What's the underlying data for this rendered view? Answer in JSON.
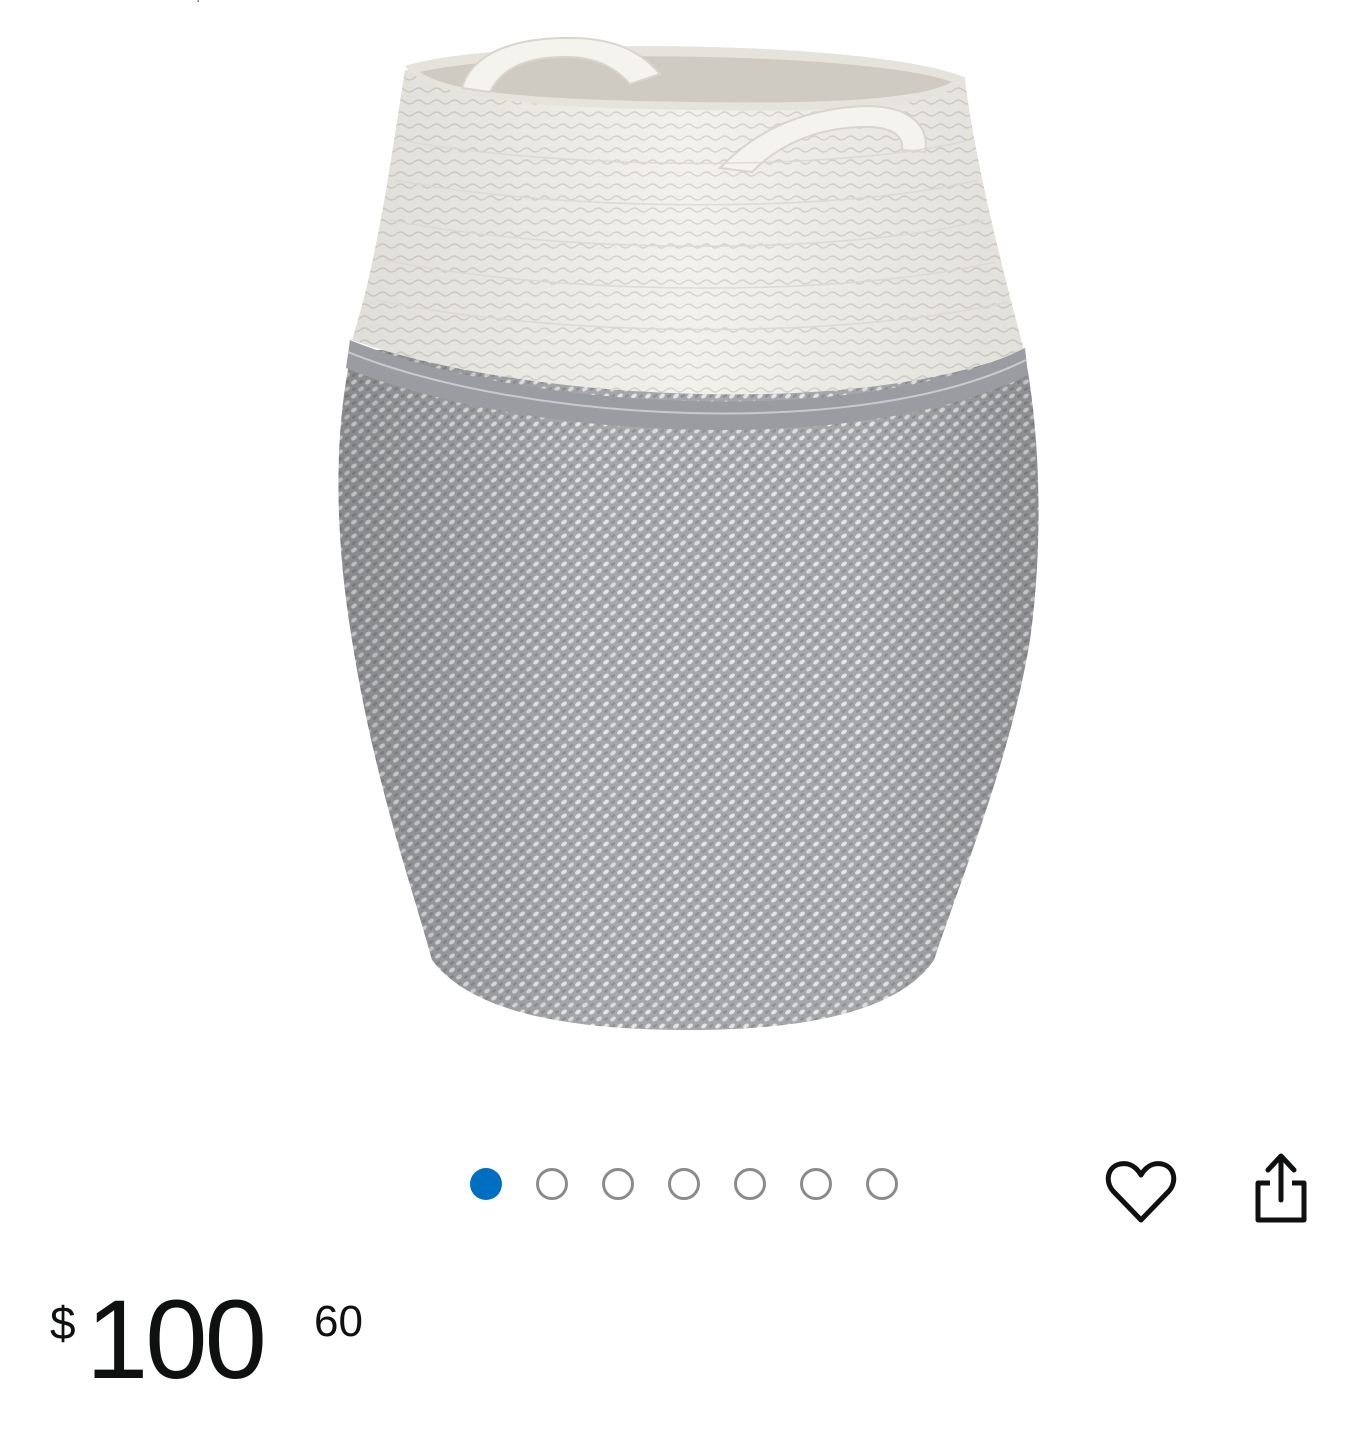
{
  "header": {
    "top_fragment": ","
  },
  "product": {
    "image_icon": "woven-rope-laundry-basket",
    "colors": {
      "basket_top": "#f1efe9",
      "basket_band": "#9c9ea3",
      "basket_body": "#b8b9bb",
      "carousel_active": "#006fc2",
      "carousel_inactive": "#8b8b8b"
    }
  },
  "carousel": {
    "total": 7,
    "active_index": 0
  },
  "actions": {
    "favorite_icon": "heart-outline-icon",
    "share_icon": "share-icon"
  },
  "price": {
    "symbol": "$",
    "whole": "100",
    "fraction": "60"
  }
}
